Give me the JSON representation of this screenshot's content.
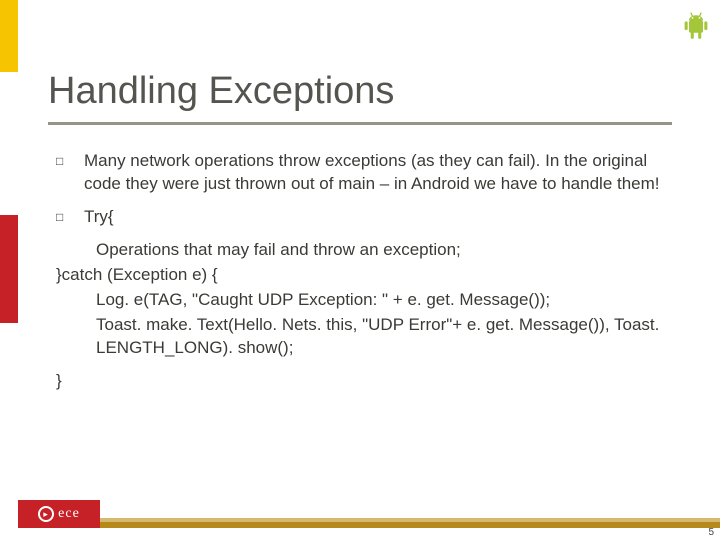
{
  "slide": {
    "title": "Handling Exceptions",
    "page_number": "5"
  },
  "bullets": [
    "Many network operations throw exceptions (as they can fail). In the original code they were just thrown out of main – in Android we have to handle them!",
    "Try{"
  ],
  "code": {
    "line_ops": "Operations that may fail and throw an exception;",
    "line_catch": "}catch (Exception e) {",
    "line_log": "Log. e(TAG, \"Caught UDP Exception: \" + e. get. Message());",
    "line_toast": "Toast. make. Text(Hello. Nets. this, \"UDP Error\"+ e. get. Message()), Toast. LENGTH_LONG). show();",
    "line_close": "}"
  },
  "icons": {
    "android": "android-icon",
    "bullet": "□"
  },
  "logo": {
    "text": "ece"
  }
}
